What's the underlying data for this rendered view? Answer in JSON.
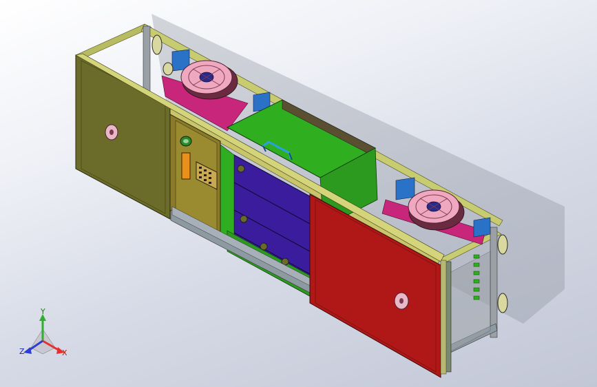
{
  "window": {
    "background_top": "#ffffff",
    "background_bottom": "#c2c7d6"
  },
  "triad": {
    "x_label": "X",
    "y_label": "Y",
    "z_label": "Z",
    "x_color": "#e53030",
    "y_color": "#2fae2f",
    "z_color": "#2b3fd6"
  },
  "model": {
    "left_door_color": "#6b6b2a",
    "right_door_color": "#b01818",
    "center_box_color": "#2fae1f",
    "drawer_color": "#3a1c9c",
    "frame_color": "#9aa0a6",
    "fan_color": "#f0a8c0",
    "icons": [
      "fan-icon",
      "handle-icon",
      "keypad-icon",
      "flange-icon"
    ]
  }
}
